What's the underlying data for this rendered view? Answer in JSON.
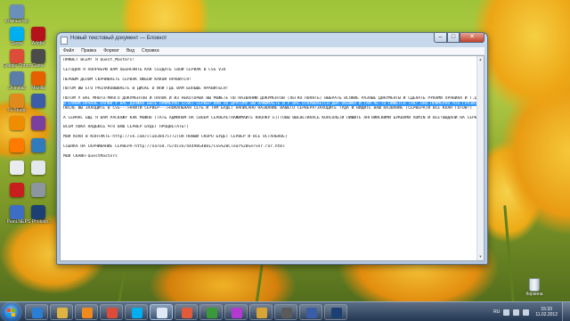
{
  "desktop": {
    "icons": [
      {
        "label": "Компьютер",
        "icon": "computer-icon",
        "color": "#6a8fb8"
      },
      {
        "label": "Skype",
        "icon": "skype-icon",
        "color": "#00aff0"
      },
      {
        "label": "Google Chrome",
        "icon": "chrome-icon",
        "color": "#dd4b39"
      },
      {
        "label": "Uninstall",
        "icon": "uninstall-icon",
        "color": "#5a7ea8"
      },
      {
        "label": "FL Studio",
        "icon": "fl-studio-icon",
        "color": "#e08a1e"
      },
      {
        "label": "",
        "icon": "vlc-icon",
        "color": "#f08c00"
      },
      {
        "label": "",
        "icon": "avast-icon",
        "color": "#ff7a00"
      },
      {
        "label": "",
        "icon": "file-icon",
        "color": "#e9ecef"
      },
      {
        "label": "",
        "icon": "acrobat-icon",
        "color": "#c81e1e"
      },
      {
        "label": "Paint.NET",
        "icon": "paint-net-icon",
        "color": "#3d6ec4"
      },
      {
        "label": "Корзина",
        "icon": "recycle-bin-icon",
        "color": "#cfd8e0"
      },
      {
        "label": "Adobe",
        "icon": "adobe-icon",
        "color": "#b5121b"
      },
      {
        "label": "Game",
        "icon": "game-icon",
        "color": "#4b4b4b"
      },
      {
        "label": "Mozilla",
        "icon": "firefox-icon",
        "color": "#e66000"
      },
      {
        "label": "",
        "icon": "video-icon",
        "color": "#3b5da8"
      },
      {
        "label": "",
        "icon": "archive-icon",
        "color": "#7b3fa0"
      },
      {
        "label": "",
        "icon": "music-icon",
        "color": "#2f7bbd"
      },
      {
        "label": "",
        "icon": "document-icon",
        "color": "#e4e7eb"
      },
      {
        "label": "",
        "icon": "printer-icon",
        "color": "#8c96a0"
      },
      {
        "label": "PS Photosh...",
        "icon": "photoshop-icon",
        "color": "#1c3f74"
      }
    ],
    "recycle_bin_label": "Корзина"
  },
  "window": {
    "title": "Новый текстовый документ — Блокнот",
    "menu": [
      "Файл",
      "Правка",
      "Формат",
      "Вид",
      "Справка"
    ],
    "lines": [
      {
        "text": "ПРИВЕТ ВСЕМ! Я Quest_Masters!",
        "selected": false
      },
      {
        "text": "",
        "selected": false
      },
      {
        "text": "СЕГОДНЯ Я ПОПРОБУЮ ВАМ ОБЪЯСНИТЬ КАК СОЗДАТЬ СВОЙ СЕРВАК В CSS V34",
        "selected": false
      },
      {
        "text": "",
        "selected": false
      },
      {
        "text": "ПЕРВЫМ ДЕЛОМ СКАЧИВАЕТЕ СЕРВАК ЛЮБОЙ КАКОЙ НРАВИТСЯ!",
        "selected": false
      },
      {
        "text": "",
        "selected": false
      },
      {
        "text": "ПОТОМ ВЫ ЕГО РАСПАКОВЫВАЕТЕ  В ДИСКЕ D ИЛИ ГДЕ ВАМ БОЛЬШЕ НРАВИТЬСЯ!",
        "selected": false
      },
      {
        "text": "",
        "selected": false
      },
      {
        "text": "ПОТОМ У ВАС МНОГО-МНОГО ДОКУМЕНТОВ И ПАПОК И ИЗ НЕКОТОРЫХ ВЫ МОЖЕТЕ ПО НАЗВАНИЮ ДОКУМЕНТОВ (ЛЕГКО ПОНЯТЬ) ВЫБРАТЬ ВСЯКИЕ РАЗНЫЕ ДОКУМЕНТЫ И СДЕЛАТЬ РУКАМИ ПРАВИЛА И Т.Д!-МОЗВ",
        "selected": false
      },
      {
        "text": "В САМОМ НАЧАЛЕ ПАПКИ У ВАС ДОЛЖНО БЫТЬ ПРИМЕРНО START СЕРВЕР ИЛИ ПО ДРУГОМУ ВЫ НАЖИМАЕТЕ И У ВАС ОТКРЫВАЕТСЯ ДВА ОКОШКА И ТАМ ЧЕ-ТО ПИШЕТСЯ ТАК! ОНО ПРИМЕРНО ЧТО ГРУЗИТСЯ",
        "selected": true
      },
      {
        "text": "ПОСЛЕ ВЫ ЗАХОДИТЕ В CSS--->НАЙТИ СЕРВЕР--->ЛОКАЛЬНАЯ СЕТЬ И ТАМ БУДЕТ НАПИСАНО НАЗВАНИЕ ВАШЕГО СЕРВЕРА!ЗАХОДИТЕ ТУДА И ВИДИТЕ ВАШ НАЗВАНИЕ (СЕРВЕРА)И ВСЕ КЛАН ГОТОВ!)",
        "selected": false
      },
      {
        "text": "",
        "selected": false
      },
      {
        "text": "А СЕЙЧАС ЕЩЁ Я ВАМ РАСКАЖУ КАК МОЖНО (ТАТЬ АДМИНОМ НА СВОЕМ СЕРВЕРЕ!НАЖИМАЙТЕ КНОПКУ Ё(ГТОВЫ ВЫСВЕТИЛАСЬ КОНСОЛЬ)И ПИШИТЕ АНГЛИЙСКИМИ БУКВАМИ ADMIN И ВСЕ!ВЫДАЛИ НА СЕРВЕРЕ!)",
        "selected": false
      },
      {
        "text": "",
        "selected": false
      },
      {
        "text": "ВСЕМ ПОКА НАДЕЮСЬ ЧТО ВАШ СЕРВЕР БУДЕТ ПРОЦВЕТАТЬ!)",
        "selected": false
      },
      {
        "text": "",
        "selected": false
      },
      {
        "text": "МОЙ КЛАН В КОНТАКТЕ-http://vk.com/club38475772(ОН НОВЫЙ СКОРО БУДЕТ СЕРВЕР И ВСЕ ОСТАЛЬНОЕ)",
        "selected": false
      },
      {
        "text": "",
        "selected": false
      },
      {
        "text": "ССЫЛКА НА СКАЧИВАНИЕ СЕРВЕРА-http://narod.ru/disk/44490G4001/CSS%20Clear%20Server.rar.html",
        "selected": false
      },
      {
        "text": "",
        "selected": false
      },
      {
        "text": "МОЙ СКАЙП-QuestMasters",
        "selected": false
      }
    ]
  },
  "taskbar": {
    "buttons": [
      {
        "icon": "ie-icon",
        "color": "#2a7fd4",
        "active": false
      },
      {
        "icon": "explorer-icon",
        "color": "#e0b443",
        "active": false
      },
      {
        "icon": "media-player-icon",
        "color": "#f08a1c",
        "active": false
      },
      {
        "icon": "chrome-icon",
        "color": "#dd4b39",
        "active": false
      },
      {
        "icon": "skype-icon",
        "color": "#00aff0",
        "active": false
      },
      {
        "icon": "notepad-icon",
        "color": "#dfe9f5",
        "active": true
      },
      {
        "icon": "paint-icon",
        "color": "#e05a3b",
        "active": false
      },
      {
        "icon": "media-icon",
        "color": "#3a9a3a",
        "active": false
      },
      {
        "icon": "music-icon",
        "color": "#b33ad1",
        "active": false
      },
      {
        "icon": "folder-icon",
        "color": "#d7a536",
        "active": false
      },
      {
        "icon": "game-icon",
        "color": "#5a5a5a",
        "active": false
      },
      {
        "icon": "video-icon",
        "color": "#3b5da8",
        "active": false
      },
      {
        "icon": "photoshop-icon",
        "color": "#1c3f74",
        "active": false
      }
    ],
    "language": "RU",
    "time": "15:33",
    "date": "11.02.2012"
  }
}
